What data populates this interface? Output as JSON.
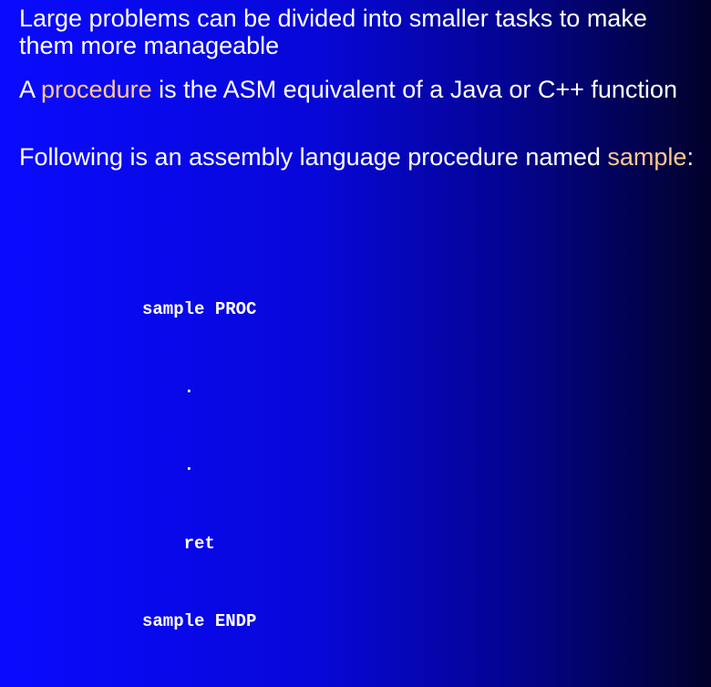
{
  "bullets": [
    {
      "text": "Large problems can be divided into smaller tasks to make them more manageable"
    },
    {
      "before": "A ",
      "highlight": "procedure",
      "after": " is the ASM equivalent of a Java or C++ function"
    },
    {
      "before": "Following is an assembly language procedure named ",
      "highlight": "sample",
      "after": ":"
    }
  ],
  "code_lines": [
    "sample PROC",
    "    .",
    "    .",
    "    ret",
    "sample ENDP"
  ],
  "colors": {
    "background_start": "#0a0aff",
    "background_end": "#01012a",
    "text": "#ffffff",
    "highlight": "#ffc890"
  }
}
